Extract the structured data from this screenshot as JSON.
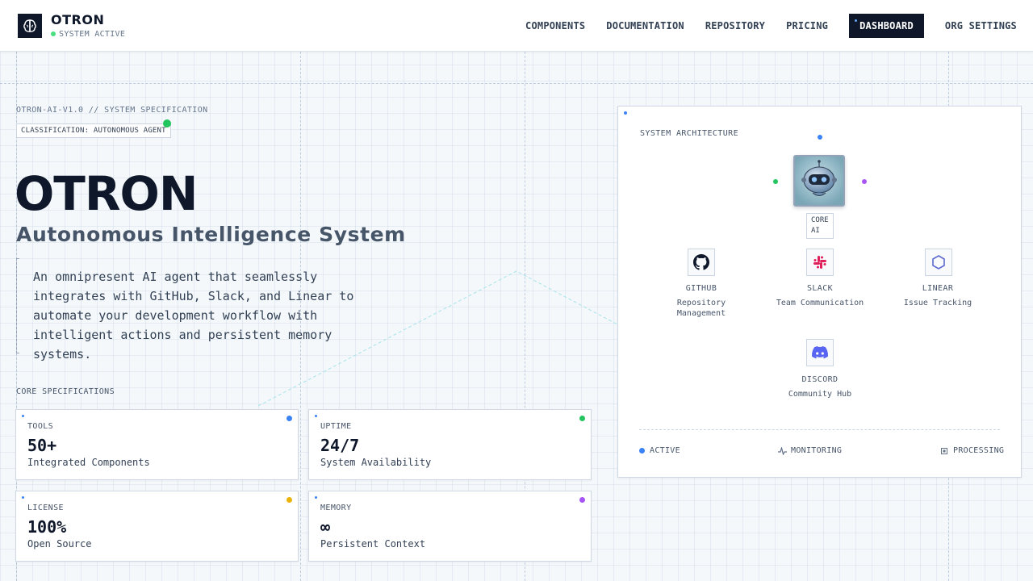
{
  "header": {
    "brand_name": "OTRON",
    "status": "SYSTEM ACTIVE",
    "nav": [
      "COMPONENTS",
      "DOCUMENTATION",
      "REPOSITORY",
      "PRICING",
      "DASHBOARD",
      "ORG SETTINGS"
    ],
    "active_nav": "DASHBOARD"
  },
  "hero": {
    "spec_line": "OTRON-AI-V1.0 // SYSTEM SPECIFICATION",
    "classification": "CLASSIFICATION: AUTONOMOUS AGENT",
    "title": "OTRON",
    "subtitle": "Autonomous Intelligence System",
    "description": "An omnipresent AI agent that seamlessly integrates with GitHub, Slack, and Linear to automate your development workflow with intelligent actions and persistent memory systems."
  },
  "core_specs": {
    "title": "CORE SPECIFICATIONS",
    "cards": [
      {
        "label": "TOOLS",
        "value": "50+",
        "desc": "Integrated Components",
        "dot_color": "#3b82f6"
      },
      {
        "label": "UPTIME",
        "value": "24/7",
        "desc": "System Availability",
        "dot_color": "#22c55e"
      },
      {
        "label": "LICENSE",
        "value": "100%",
        "desc": "Open Source",
        "dot_color": "#eab308"
      },
      {
        "label": "MEMORY",
        "value": "∞",
        "desc": "Persistent Context",
        "dot_color": "#a855f7"
      }
    ]
  },
  "architecture": {
    "title": "SYSTEM ARCHITECTURE",
    "core_label_1": "CORE",
    "core_label_2": "AI",
    "integrations": [
      {
        "name": "GITHUB",
        "desc": "Repository Management",
        "icon": "github-icon"
      },
      {
        "name": "SLACK",
        "desc": "Team Communication",
        "icon": "slack-icon"
      },
      {
        "name": "LINEAR",
        "desc": "Issue Tracking",
        "icon": "linear-icon"
      },
      {
        "name": "DISCORD",
        "desc": "Community Hub",
        "icon": "discord-icon"
      }
    ],
    "legend": {
      "active": "ACTIVE",
      "monitoring": "MONITORING",
      "processing": "PROCESSING"
    }
  },
  "colors": {
    "brand_dark": "#0f172a",
    "accent_blue": "#3b82f6",
    "green": "#22c55e",
    "purple": "#a855f7",
    "yellow": "#eab308"
  }
}
